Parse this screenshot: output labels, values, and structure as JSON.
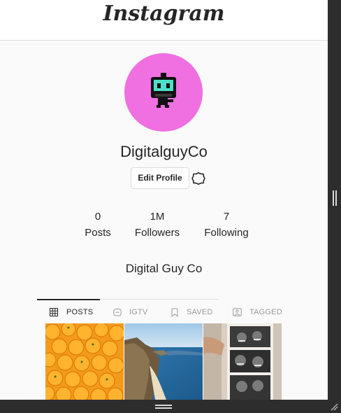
{
  "header": {
    "logo_text": "Instagram"
  },
  "profile": {
    "username": "DigitalguyCo",
    "edit_profile_label": "Edit Profile",
    "full_name": "Digital Guy Co",
    "avatar_bg": "#f06fe1"
  },
  "stats": [
    {
      "value": "0",
      "label": "Posts"
    },
    {
      "value": "1M",
      "label": "Followers"
    },
    {
      "value": "7",
      "label": "Following"
    }
  ],
  "tabs": [
    {
      "label": "POSTS",
      "icon": "grid-icon",
      "active": true
    },
    {
      "label": "IGTV",
      "icon": "igtv-icon",
      "active": false
    },
    {
      "label": "SAVED",
      "icon": "bookmark-icon",
      "active": false
    },
    {
      "label": "TAGGED",
      "icon": "tag-person-icon",
      "active": false
    }
  ],
  "posts": [
    {
      "subject": "oranges"
    },
    {
      "subject": "coastline"
    },
    {
      "subject": "photo-booth-strip"
    }
  ]
}
